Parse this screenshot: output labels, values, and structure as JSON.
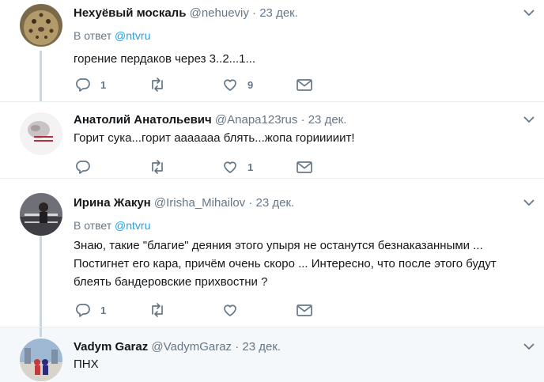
{
  "tweets": [
    {
      "name": "Нехуёвый москаль",
      "handle": "@nehueviy",
      "date": "23 дек.",
      "reply_prefix": "В ответ",
      "reply_to": "@ntvru",
      "text": "горение пердаков через 3..2...1...",
      "replies": "1",
      "retweets": "",
      "likes": "9"
    },
    {
      "name": "Анатолий Анатольевич",
      "handle": "@Anapa123rus",
      "date": "23 дек.",
      "text": "Горит сука...горит ааааааа блять...жопа горииииит!",
      "replies": "",
      "retweets": "",
      "likes": "1"
    },
    {
      "name": "Ирина Жакун",
      "handle": "@Irisha_Mihailov",
      "date": "23 дек.",
      "reply_prefix": "В ответ",
      "reply_to": "@ntvru",
      "text_lines": [
        "Знаю, такие \"благие\" деяния этого упыря не останутся безнаказанными ...",
        "Постигнет его кара, причём очень скоро ... Интересно, что после этого будут",
        "блеять бандеровские прихвостни ?"
      ],
      "replies": "1",
      "retweets": "",
      "likes": ""
    },
    {
      "name": "Vadym Garaz",
      "handle": "@VadymGaraz",
      "date": "23 дек.",
      "text": "ПНХ"
    }
  ],
  "separator": "·",
  "colors": {
    "accent": "#1da1f2",
    "muted": "#657786",
    "line": "#ccd6dd"
  }
}
